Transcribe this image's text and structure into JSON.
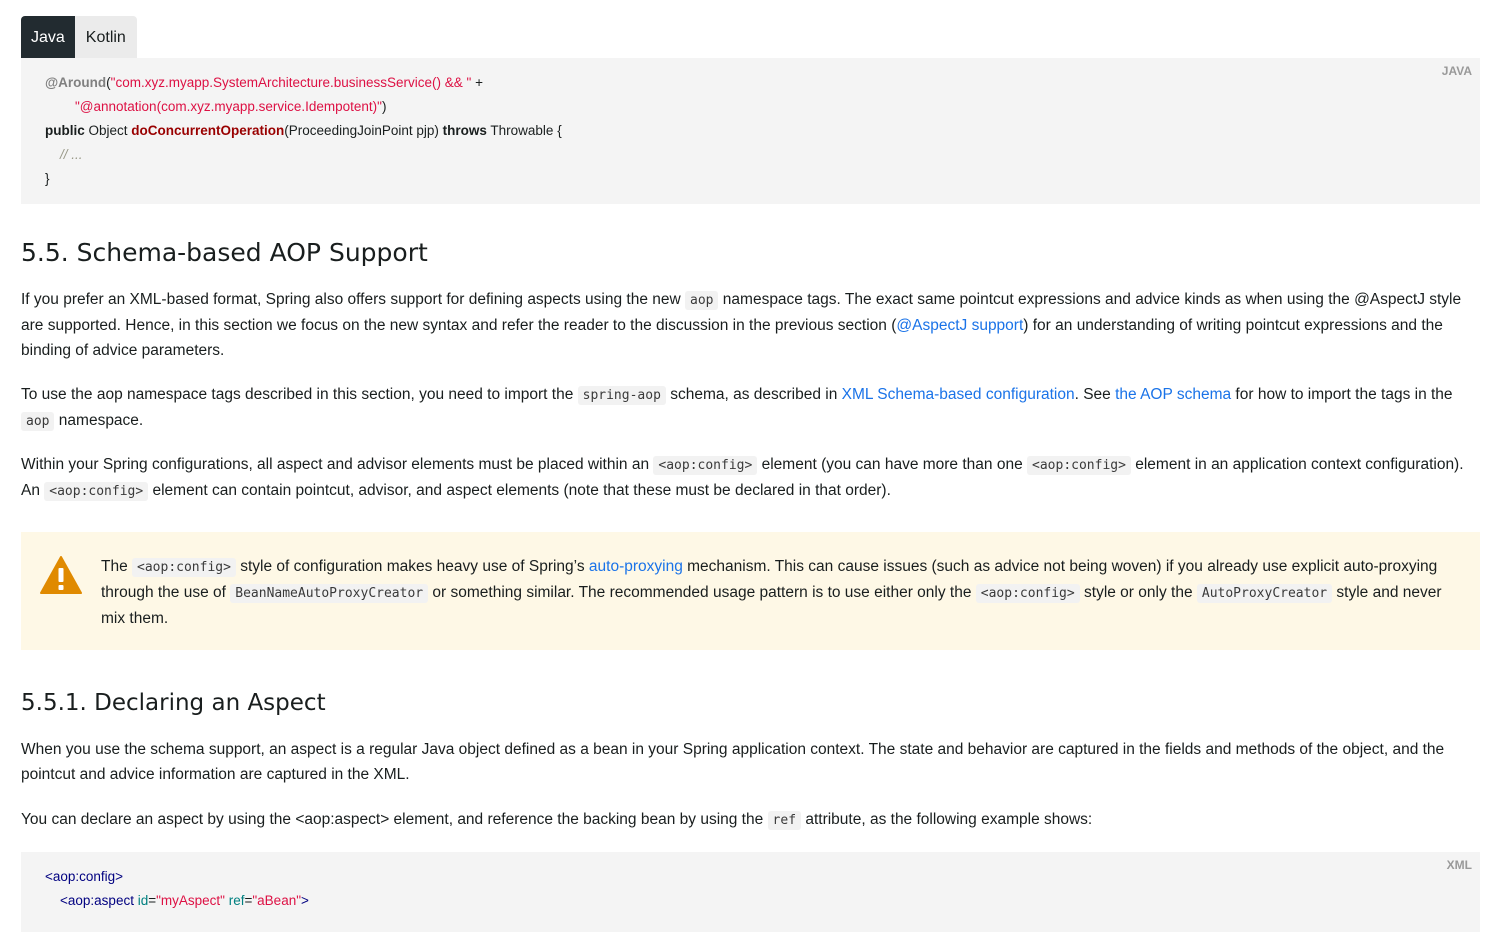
{
  "tabs": [
    "Java",
    "Kotlin"
  ],
  "code1": {
    "lang": "JAVA",
    "line1": {
      "annotation": "@Around",
      "open": "(",
      "str": "\"com.xyz.myapp.SystemArchitecture.businessService() && \"",
      "plus": " +"
    },
    "line2": {
      "indent": "        ",
      "str": "\"@annotation(com.xyz.myapp.service.Idempotent)\"",
      "close": ")"
    },
    "line3": {
      "kw1": "public",
      "type": " Object ",
      "fn": "doConcurrentOperation",
      "params": "(ProceedingJoinPoint pjp) ",
      "kw2": "throws",
      "rest": " Throwable {"
    },
    "line4": {
      "indent": "    ",
      "comment": "// ..."
    },
    "line5": "}"
  },
  "section_title": "5.5. Schema-based AOP Support",
  "p1": {
    "a": "If you prefer an XML-based format, Spring also offers support for defining aspects using the new ",
    "code_aop": "aop",
    "b": " namespace tags. The exact same pointcut expressions and advice kinds as when using the @AspectJ style are supported. Hence, in this section we focus on the new syntax and refer the reader to the discussion in the previous section (",
    "link": "@AspectJ support",
    "c": ") for an understanding of writing pointcut expressions and the binding of advice parameters."
  },
  "p2": {
    "a": "To use the aop namespace tags described in this section, you need to import the ",
    "code_spring_aop": "spring-aop",
    "b": " schema, as described in ",
    "link1": "XML Schema-based configuration",
    "c": ". See ",
    "link2": "the AOP schema",
    "d": " for how to import the tags in the ",
    "code_aop": "aop",
    "e": " namespace."
  },
  "p3": {
    "a": "Within your Spring configurations, all aspect and advisor elements must be placed within an ",
    "code1": "<aop:config>",
    "b": " element (you can have more than one ",
    "code2": "<aop:config>",
    "c": " element in an application context configuration). An ",
    "code3": "<aop:config>",
    "d": " element can contain pointcut, advisor, and aspect elements (note that these must be declared in that order)."
  },
  "warning": {
    "icon": "warning-triangle-icon",
    "color": "#e08a00",
    "a": "The ",
    "code1": "<aop:config>",
    "b": " style of configuration makes heavy use of Spring’s ",
    "link": "auto-proxying",
    "c": " mechanism. This can cause issues (such as advice not being woven) if you already use explicit auto-proxying through the use of ",
    "code2": "BeanNameAutoProxyCreator",
    "d": " or something similar. The recommended usage pattern is to use either only the ",
    "code3": "<aop:config>",
    "e": " style or only the ",
    "code4": "AutoProxyCreator",
    "f": " style and never mix them."
  },
  "subsection_title": "5.5.1. Declaring an Aspect",
  "p4": "When you use the schema support, an aspect is a regular Java object defined as a bean in your Spring application context. The state and behavior are captured in the fields and methods of the object, and the pointcut and advice information are captured in the XML.",
  "p5": {
    "a": "You can declare an aspect by using the <aop:aspect> element, and reference the backing bean by using the ",
    "code_ref": "ref",
    "b": " attribute, as the following example shows:"
  },
  "code2": {
    "lang": "XML",
    "line1": "<aop:config>",
    "line2": {
      "indent": "    ",
      "tag": "<aop:aspect",
      "attr1": " id",
      "eq1": "=",
      "val1": "\"myAspect\"",
      "attr2": " ref",
      "eq2": "=",
      "val2": "\"aBean\"",
      "close": ">"
    }
  }
}
